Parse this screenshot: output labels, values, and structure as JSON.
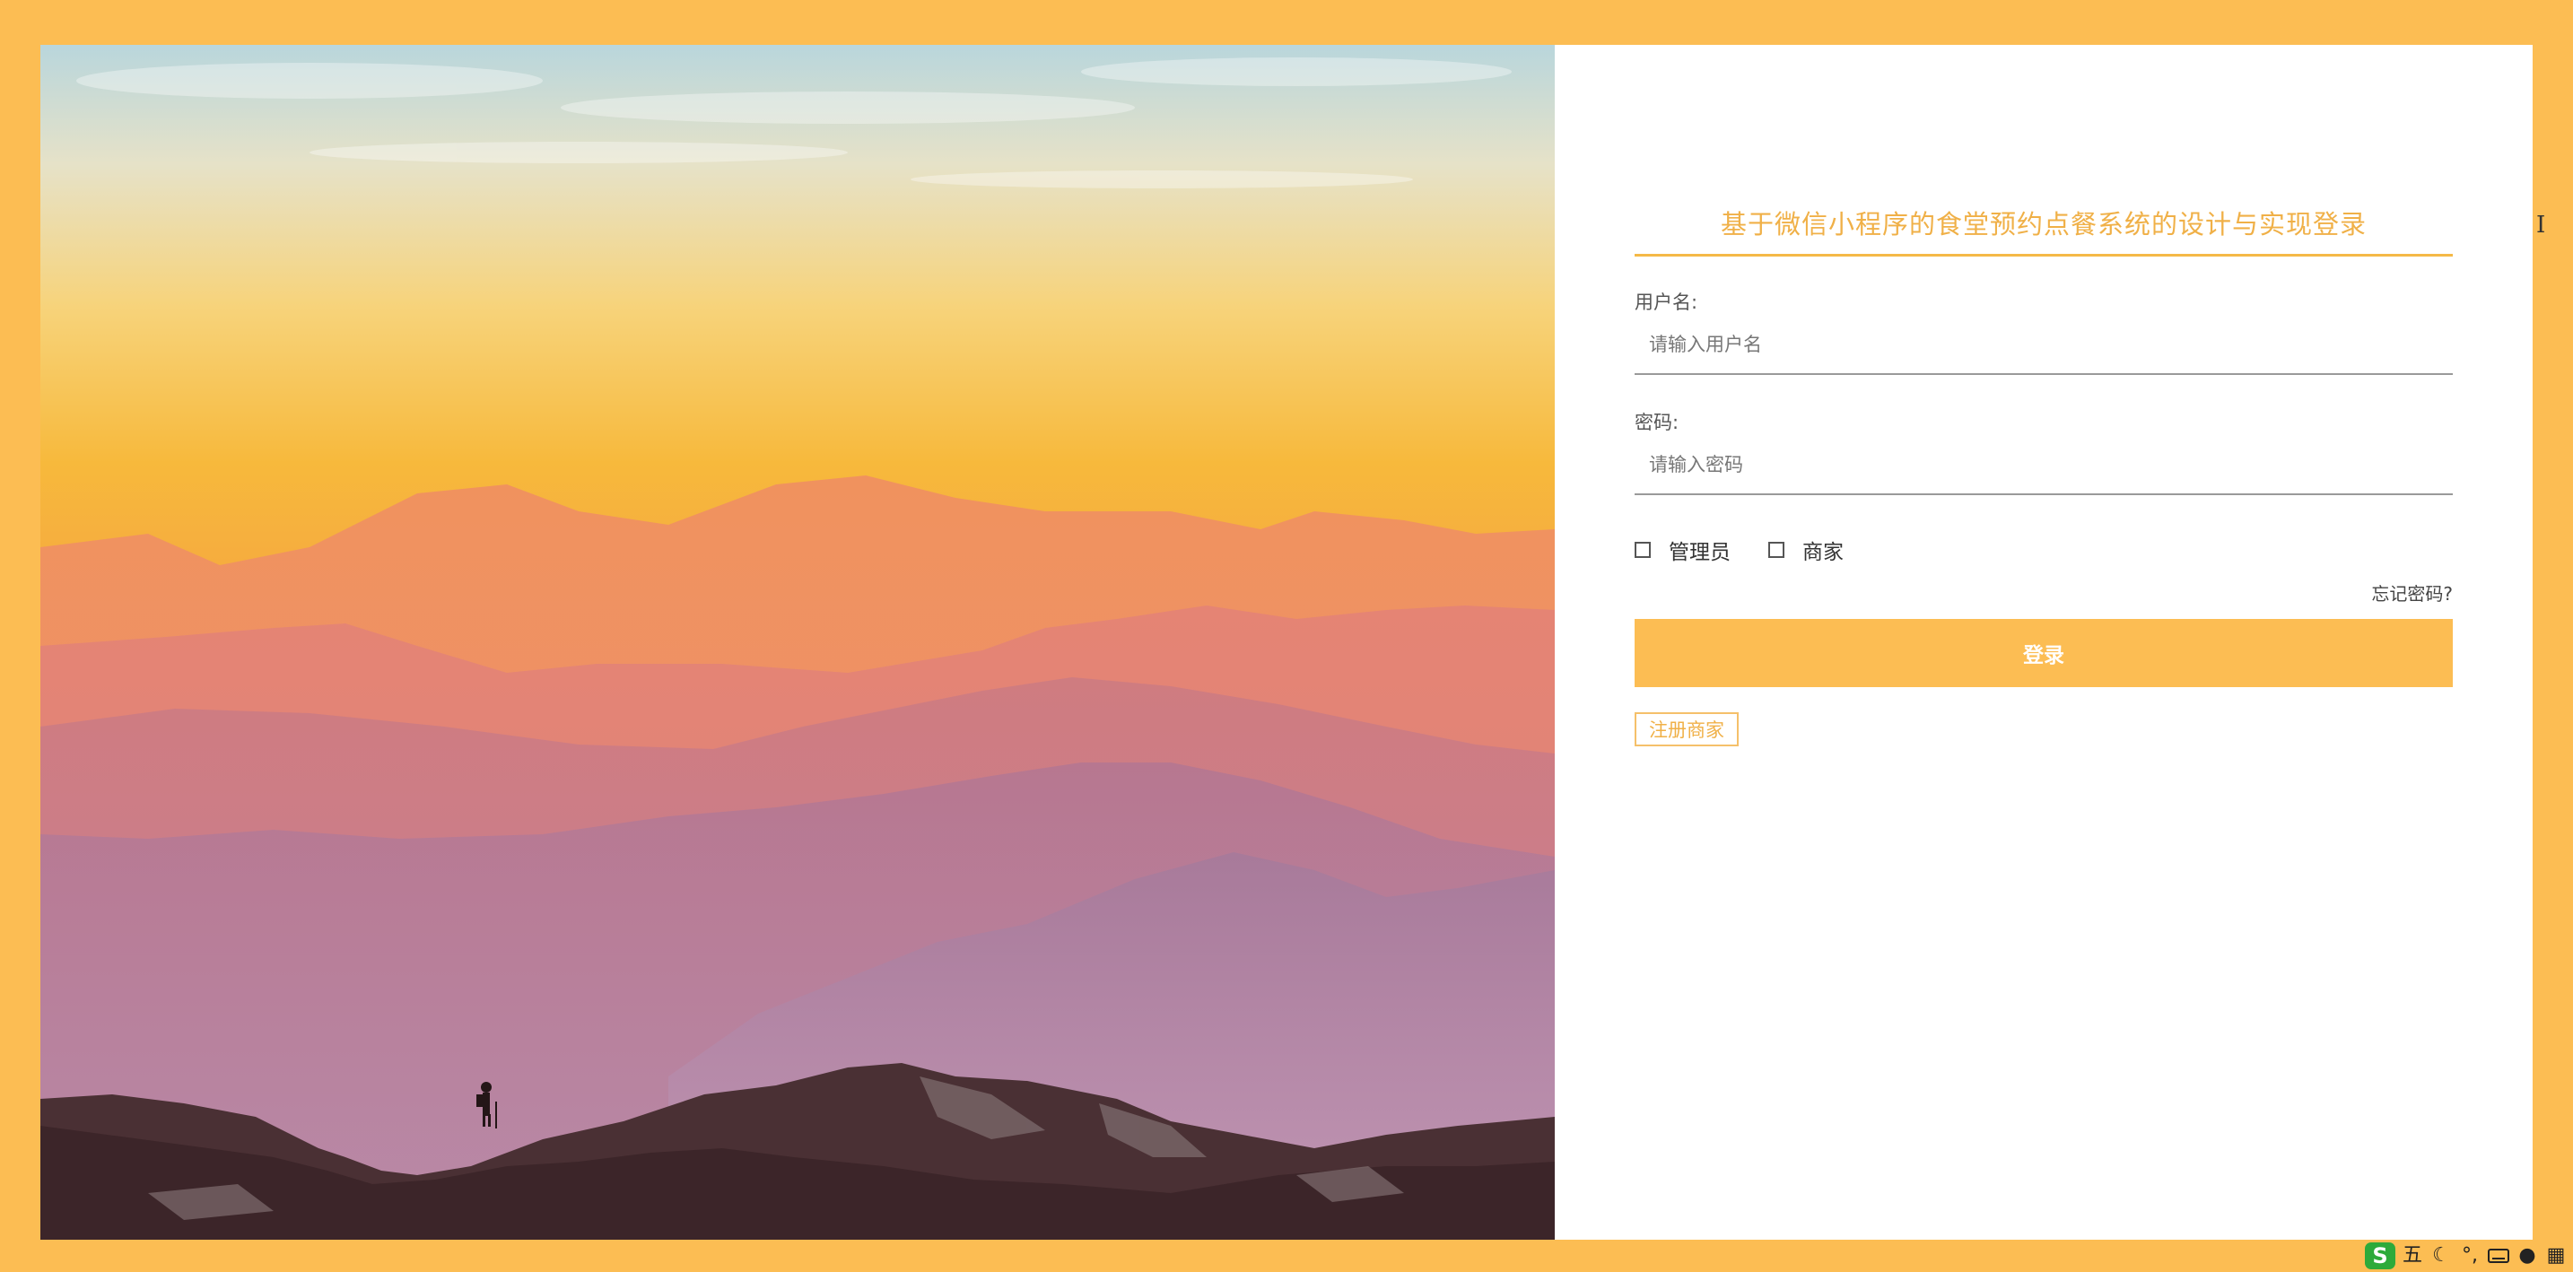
{
  "title": "基于微信小程序的食堂预约点餐系统的设计与实现登录",
  "username": {
    "label": "用户名:",
    "placeholder": "请输入用户名"
  },
  "password": {
    "label": "密码:",
    "placeholder": "请输入密码"
  },
  "roles": [
    {
      "label": "管理员",
      "checked": false
    },
    {
      "label": "商家",
      "checked": false
    }
  ],
  "forgot_password": "忘记密码?",
  "login_button": "登录",
  "register_link": "注册商家",
  "colors": {
    "accent": "#fcbd53",
    "title": "#f0b047",
    "background": "#ffffff"
  },
  "system_tray": {
    "ime_logo": "S",
    "ime_mode": "五",
    "icons": [
      "moon-icon",
      "punctuation-icon",
      "keyboard-icon",
      "user-icon",
      "grid-icon"
    ]
  }
}
